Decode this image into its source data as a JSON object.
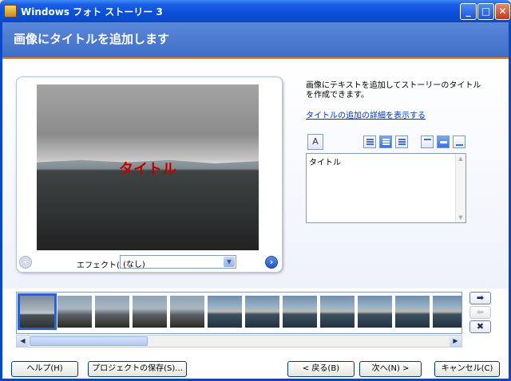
{
  "window": {
    "title": "Windows フォト ストーリー 3"
  },
  "title_buttons": {
    "minimize": "_",
    "maximize": "□",
    "close": "✕"
  },
  "header": {
    "title": "画像にタイトルを追加します"
  },
  "preview": {
    "overlay_title": "タイトル",
    "effect_label": "エフェクト(E):",
    "effect_value": "(なし)",
    "prev_glyph": "‹",
    "next_glyph": "›"
  },
  "instructions": {
    "text": "画像にテキストを追加してストーリーのタイトルを作成できます。",
    "link": "タイトルの追加の詳細を表示する"
  },
  "toolbar": {
    "font_glyph": "A"
  },
  "textbox": {
    "value": "タイトル"
  },
  "filmstrip": {
    "thumbnails": [
      {
        "palette": "sky"
      },
      {
        "palette": "deck"
      },
      {
        "palette": "deck"
      },
      {
        "palette": "deck"
      },
      {
        "palette": "deck"
      },
      {
        "palette": "sea"
      },
      {
        "palette": "sea"
      },
      {
        "palette": "sea"
      },
      {
        "palette": "sea"
      },
      {
        "palette": "sea"
      },
      {
        "palette": "sea"
      },
      {
        "palette": "sea"
      }
    ],
    "move_right": "➡",
    "move_left": "⬅",
    "remove": "✖"
  },
  "buttons": {
    "help": "ヘルプ(H)",
    "save_project": "プロジェクトの保存(S)...",
    "back": "< 戻る(B)",
    "next": "次へ(N) >",
    "cancel": "キャンセル(C)"
  },
  "colors": {
    "title_bar": "#0a47c6",
    "header": "#4c7ad0",
    "accent_line": "#f07a1a",
    "overlay_text": "#c00000"
  }
}
